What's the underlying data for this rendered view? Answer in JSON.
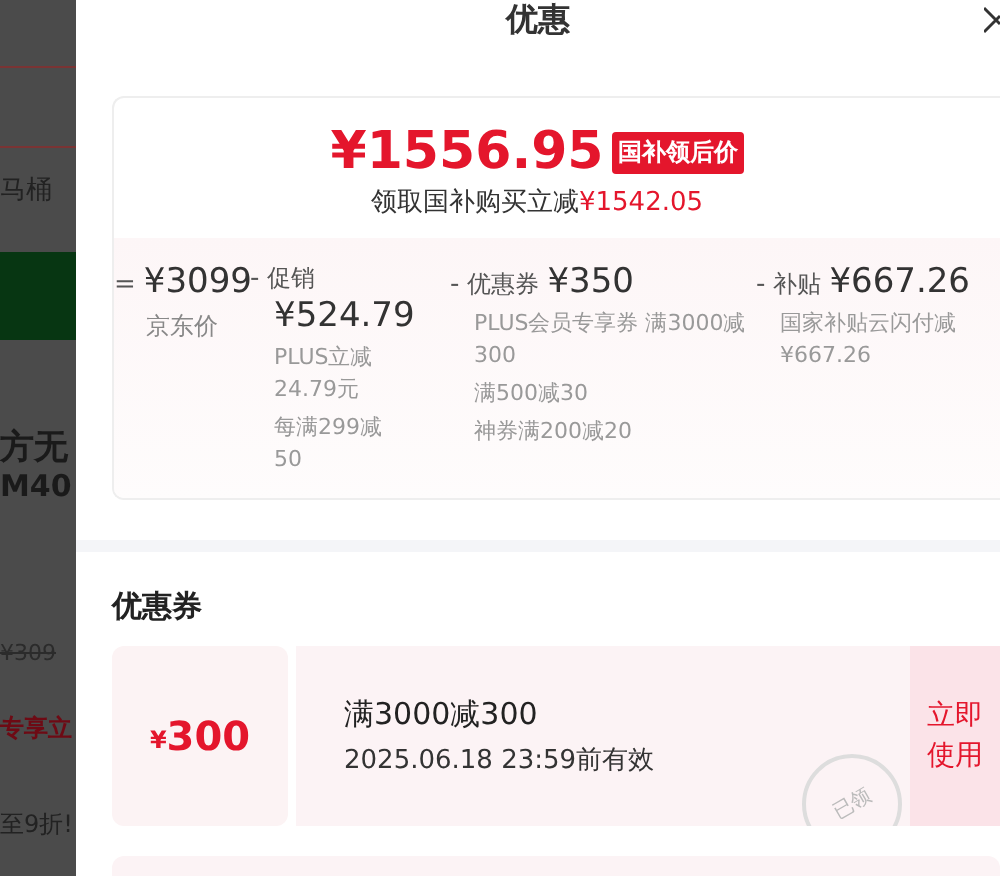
{
  "background_page": {
    "texts": [
      "马桶",
      "方无",
      "M40",
      "¥309",
      "专享立",
      "至9折!"
    ]
  },
  "sheet": {
    "title": "优惠"
  },
  "price_card": {
    "price": "¥1556.95",
    "badge": "国补领后价",
    "saving_label": "领取国补购买立减",
    "saving_amount": "¥1542.05",
    "breakdown": [
      {
        "kind": "base",
        "operator": "=",
        "amount": "¥3099",
        "label": "京东价"
      },
      {
        "kind": "stacked",
        "operator": "-",
        "label": "促销",
        "amount": "¥524.79",
        "notes": [
          "PLUS立减24.79元",
          "每满299减50"
        ]
      },
      {
        "kind": "inline",
        "operator": "-",
        "label": "优惠券",
        "amount": "¥350",
        "notes": [
          "PLUS会员专享券 满3000减300",
          "满500减30",
          "神券满200减20"
        ]
      },
      {
        "kind": "inline",
        "operator": "-",
        "label": "补贴",
        "amount": "¥667.26",
        "notes": [
          "国家补贴云闪付减¥667.26"
        ]
      }
    ]
  },
  "coupons": {
    "heading": "优惠券",
    "items": [
      {
        "currency": "¥",
        "amount": "300",
        "title": "满3000减300",
        "validity": "2025.06.18 23:59前有效",
        "claimed": true,
        "stamp": "已领",
        "action": "立即使用"
      }
    ]
  }
}
